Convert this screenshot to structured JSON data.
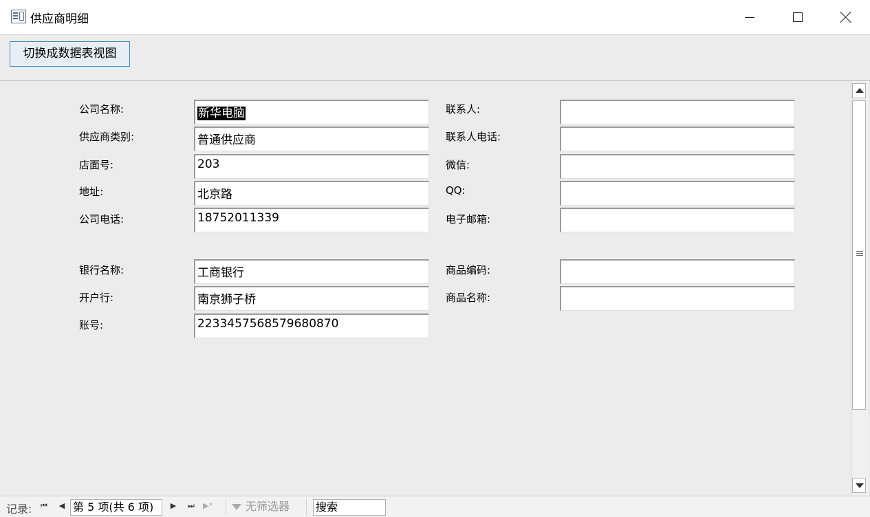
{
  "window": {
    "title": "供应商明细",
    "minimize_label": "—",
    "maximize_label": "☐",
    "close_label": "✕"
  },
  "toolbar": {
    "switch_button": "切换成数据表视图"
  },
  "left_fields": [
    {
      "label": "公司名称:",
      "value": "新华电脑"
    },
    {
      "label": "供应商类别:",
      "value": "普通供应商"
    },
    {
      "label": "店面号:",
      "value": "203"
    },
    {
      "label": "地址:",
      "value": "北京路"
    },
    {
      "label": "公司电话:",
      "value": "18752011339"
    },
    {
      "label": "银行名称:",
      "value": "工商银行"
    },
    {
      "label": "开户行:",
      "value": "南京狮子桥"
    },
    {
      "label": "账号:",
      "value": "2233457568579680870"
    }
  ],
  "right_fields": [
    {
      "label": "联系人:",
      "value": ""
    },
    {
      "label": "联系人电话:",
      "value": ""
    },
    {
      "label": "微信:",
      "value": ""
    },
    {
      "label": "QQ:",
      "value": ""
    },
    {
      "label": "电子邮箱:",
      "value": ""
    },
    {
      "label": "商品编码:",
      "value": ""
    },
    {
      "label": "商品名称:",
      "value": ""
    }
  ],
  "navigation": {
    "record_label": "记录:",
    "first": "⏮",
    "prev": "◀",
    "current": "第 5 项(共 6 项)",
    "next": "▶",
    "last": "⏭",
    "new": "▶*",
    "filter_label": "无筛选器",
    "search_label": "搜索"
  }
}
